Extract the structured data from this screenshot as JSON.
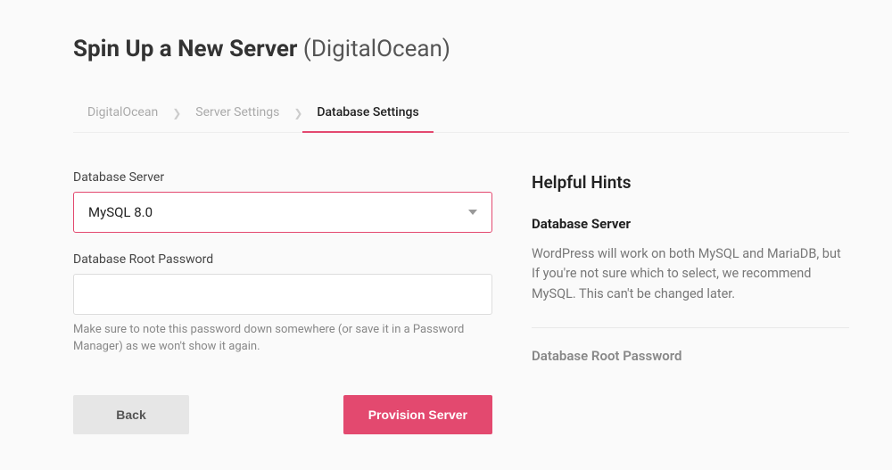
{
  "header": {
    "title_bold": "Spin Up a New Server",
    "title_light": "(DigitalOcean)"
  },
  "tabs": {
    "digitalocean": "DigitalOcean",
    "server_settings": "Server Settings",
    "database_settings": "Database Settings"
  },
  "form": {
    "db_server_label": "Database Server",
    "db_server_value": "MySQL 8.0",
    "db_root_pw_label": "Database Root Password",
    "db_root_pw_value": "",
    "db_root_pw_helper": "Make sure to note this password down somewhere (or save it in a Password Manager) as we won't show it again."
  },
  "actions": {
    "back": "Back",
    "provision": "Provision Server"
  },
  "hints": {
    "title": "Helpful Hints",
    "db_server_heading": "Database Server",
    "db_server_body": "WordPress will work on both MySQL and MariaDB, but If you're not sure which to select, we recommend MySQL. This can't be changed later.",
    "db_root_pw_heading": "Database Root Password"
  }
}
